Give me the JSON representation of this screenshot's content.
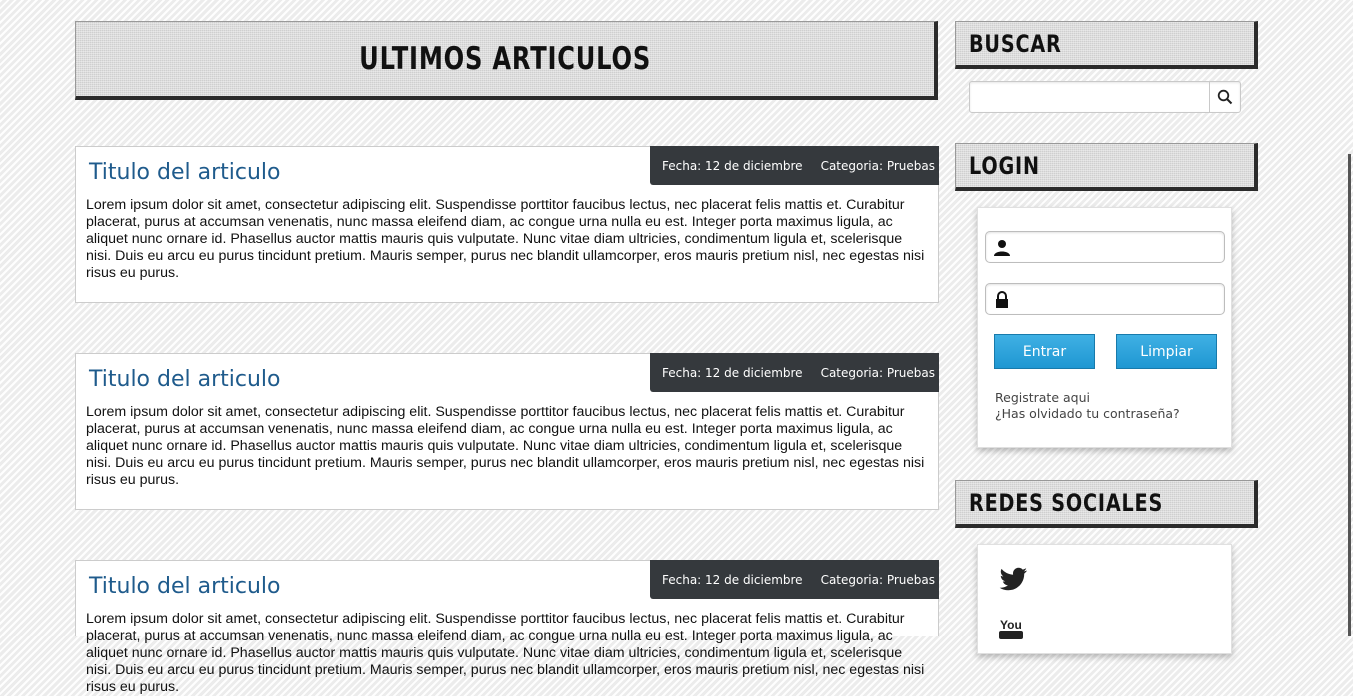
{
  "main": {
    "title": "ULTIMOS ARTICULOS",
    "articles": [
      {
        "title": "Titulo del articulo",
        "date_label": "Fecha: 12 de diciembre",
        "category_label": "Categoria: Pruebas",
        "body": "Lorem ipsum dolor sit amet, consectetur adipiscing elit. Suspendisse porttitor faucibus lectus, nec placerat felis mattis et. Curabitur placerat, purus at accumsan venenatis, nunc massa eleifend diam, ac congue urna nulla eu est. Integer porta maximus ligula, ac aliquet nunc ornare id. Phasellus auctor mattis mauris quis vulputate. Nunc vitae diam ultricies, condimentum ligula et, scelerisque nisi. Duis eu arcu eu purus tincidunt pretium. Mauris semper, purus nec blandit ullamcorper, eros mauris pretium nisl, nec egestas nisi risus eu purus."
      },
      {
        "title": "Titulo del articulo",
        "date_label": "Fecha: 12 de diciembre",
        "category_label": "Categoria: Pruebas",
        "body": "Lorem ipsum dolor sit amet, consectetur adipiscing elit. Suspendisse porttitor faucibus lectus, nec placerat felis mattis et. Curabitur placerat, purus at accumsan venenatis, nunc massa eleifend diam, ac congue urna nulla eu est. Integer porta maximus ligula, ac aliquet nunc ornare id. Phasellus auctor mattis mauris quis vulputate. Nunc vitae diam ultricies, condimentum ligula et, scelerisque nisi. Duis eu arcu eu purus tincidunt pretium. Mauris semper, purus nec blandit ullamcorper, eros mauris pretium nisl, nec egestas nisi risus eu purus."
      },
      {
        "title": "Titulo del articulo",
        "date_label": "Fecha: 12 de diciembre",
        "category_label": "Categoria: Pruebas",
        "body": "Lorem ipsum dolor sit amet, consectetur adipiscing elit. Suspendisse porttitor faucibus lectus, nec placerat felis mattis et. Curabitur placerat, purus at accumsan venenatis, nunc massa eleifend diam, ac congue urna nulla eu est. Integer porta maximus ligula, ac aliquet nunc ornare id. Phasellus auctor mattis mauris quis vulputate. Nunc vitae diam ultricies, condimentum ligula et, scelerisque nisi. Duis eu arcu eu purus tincidunt pretium. Mauris semper, purus nec blandit ullamcorper, eros mauris pretium nisl, nec egestas nisi risus eu purus."
      }
    ]
  },
  "sidebar": {
    "search": {
      "title": "BUSCAR",
      "placeholder": "",
      "icon": "search-icon"
    },
    "login": {
      "title": "LOGIN",
      "user_icon": "user-icon",
      "password_icon": "lock-icon",
      "submit_label": "Entrar",
      "clear_label": "Limpiar",
      "register_link": "Registrate aqui",
      "forgot_link": "¿Has olvidado tu contraseña?"
    },
    "social": {
      "title": "REDES SOCIALES",
      "icons": [
        "twitter-icon",
        "youtube-icon"
      ]
    }
  },
  "colors": {
    "article_title": "#1f5b8c",
    "meta_bar": "#35393d",
    "button": "#2aa3dc"
  }
}
